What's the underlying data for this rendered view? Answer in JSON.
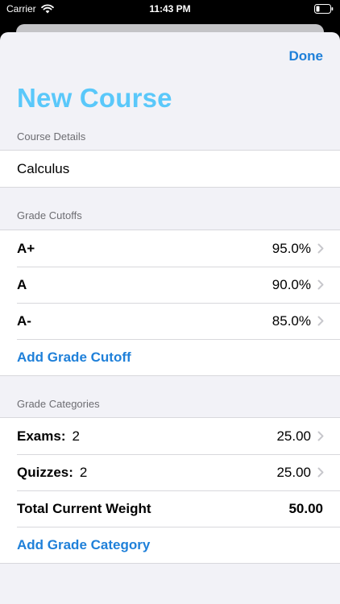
{
  "status_bar": {
    "carrier": "Carrier",
    "time": "11:43 PM"
  },
  "nav": {
    "done_label": "Done"
  },
  "title": "New Course",
  "course_details": {
    "header": "Course Details",
    "course_name": "Calculus"
  },
  "grade_cutoffs": {
    "header": "Grade Cutoffs",
    "items": [
      {
        "grade": "A+",
        "value": "95.0%"
      },
      {
        "grade": "A",
        "value": "90.0%"
      },
      {
        "grade": "A-",
        "value": "85.0%"
      }
    ],
    "add_label": "Add Grade Cutoff"
  },
  "grade_categories": {
    "header": "Grade Categories",
    "items": [
      {
        "name": "Exams:",
        "count": "2",
        "weight": "25.00"
      },
      {
        "name": "Quizzes:",
        "count": "2",
        "weight": "25.00"
      }
    ],
    "total_label": "Total Current Weight",
    "total_value": "50.00",
    "add_label": "Add Grade Category"
  },
  "colors": {
    "accent": "#1f80d9",
    "title": "#5ac8fa",
    "background": "#f2f2f7",
    "chevron": "#c7c7cc"
  },
  "icons": {
    "wifi": "wifi-icon",
    "battery": "battery-icon",
    "chevron": "chevron-right-icon"
  }
}
